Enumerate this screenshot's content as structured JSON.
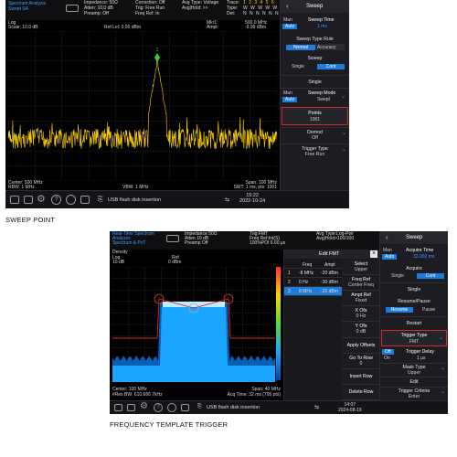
{
  "screen1": {
    "hdr": {
      "title1": "Spectrum Analysis",
      "title2": "Swept SA",
      "imp": "Impedance: 50Ω",
      "atten": "Atten: 10.0 dB",
      "preamp": "Preamp: Off",
      "corr": "Correction: Off",
      "trig": "Trig: Free Run",
      "freqref": "Freq Ref: In",
      "avgtype": "Avg Type: Voltage",
      "avghold": "Avg|Hold: >>",
      "trace_lbl": "Trace:",
      "type_lbl": "Type:",
      "det_lbl": "Det:",
      "trace_nums": "1 2 3 4 5 6",
      "type_vals": "W W W W W W",
      "det_vals": "N N N N N N"
    },
    "plot": {
      "log": "Log",
      "scale": "Scale: 10.0 dB",
      "refl": "Ref Lel: 0.00 dBm",
      "mkr": "Mkr1:",
      "ampt": "Ampt:",
      "mkr_val": "500.0 MHz",
      "ampt_val": "-9.99 dBm",
      "marker_label": "1"
    },
    "footer": {
      "center": "Center: 500 MHz",
      "rbw": "RBW: 1 MHz",
      "vbw": "VBW: 1 MHz",
      "span": "Span: 100 MHz",
      "swt": "SWT: 1 ms, pts: 1001"
    },
    "side": {
      "title": "Sweep",
      "man": "Man",
      "auto": "Auto",
      "swtime": "Sweep Time",
      "swtime_val": "1 ms",
      "typerule": "Sweep Type Rule",
      "normal": "Normal",
      "accuracy": "Accuracy",
      "sweep": "Sweep",
      "single": "Single",
      "cont": "Cont",
      "single2": "Single",
      "man2": "Man",
      "auto2": "Auto",
      "mode": "Sweep Mode",
      "mode_val": "Swept",
      "points": "Points",
      "points_val": "1001",
      "demod": "Demod",
      "demod_val": "Off",
      "trigtype": "Trigger Type",
      "trigtype_val": "Free Run"
    },
    "statusbar": {
      "usb": "USB flash disk insertion",
      "time": "15:22",
      "date": "2022-10-24"
    }
  },
  "caption1": "SWEEP POINT",
  "screen2": {
    "hdr": {
      "title1": "Real-Time Spectrum",
      "title2": "Analyzer",
      "title3": "Spectrum & PvT",
      "imp": "Impedance 50Ω",
      "atten": "Atten 10 dB",
      "preamp": "Preamp Off",
      "trig": "Trig:FMT",
      "freqref": "Freq Ref:Int(S)",
      "poi": "100%POI 6.60 µs",
      "avgtype": "Avg Type:Log-Pwr",
      "avghold": "Avg|Hold>100/100"
    },
    "plot": {
      "density": "Density",
      "log": "Log",
      "scale": "10 dB",
      "ref": "Ref",
      "ref_val": "0 dBm",
      "center": "Center: 100 MHz",
      "rbw": "#Res BW: 610.666 7kHz",
      "span": "Span: 40 MHz",
      "acq": "Acq Time: 32 ms (795 pts)"
    },
    "edit": {
      "title": "Edit FMT",
      "close": "×",
      "col_freq": "Freq",
      "col_ampt": "Ampt",
      "rows": [
        {
          "n": "1",
          "freq": "-8 MHz",
          "ampt": "-20 dBm"
        },
        {
          "n": "2",
          "freq": "0 Hz",
          "ampt": "-30 dBm"
        },
        {
          "n": "3",
          "freq": "8 MHz",
          "ampt": "-20 dBm"
        }
      ],
      "buttons": [
        {
          "l1": "Select",
          "l2": "Upper"
        },
        {
          "l1": "Freq Ref",
          "l2": "Center Freq"
        },
        {
          "l1": "Ampt Ref",
          "l2": "Fixed"
        },
        {
          "l1": "X Ofs",
          "l2": "0 Hz"
        },
        {
          "l1": "Y Ofs",
          "l2": "0 dB"
        },
        {
          "l1": "Apply Offsets",
          "l2": ""
        },
        {
          "l1": "Go To Row",
          "l2": "0"
        },
        {
          "l1": "Insert Row",
          "l2": ""
        },
        {
          "l1": "Delete Row",
          "l2": ""
        }
      ]
    },
    "side": {
      "title": "Sweep",
      "man": "Man",
      "auto": "Auto",
      "acqtime": "Acquire Time",
      "acqtime_val": "32.002 ms",
      "acquire": "Acquire",
      "single": "Single",
      "cont": "Cont",
      "single2": "Single",
      "respause": "Resume/Pause",
      "resume": "Resume",
      "pause": "Pause",
      "restart": "Restart",
      "trigtype": "Trigger Type",
      "trigtype_val": "FMT",
      "off": "Off",
      "on": "On",
      "trigdelay": "Trigger Delay",
      "trigdelay_val": "1 µs",
      "masktype": "Mask Type",
      "masktype_val": "Upper",
      "edit": "Edit",
      "criteria": "Trigger Criteria",
      "criteria_val": "Enter"
    },
    "statusbar": {
      "usb": "USB flash disk insertion",
      "time": "14:07",
      "date": "2024-08-19"
    }
  },
  "caption2": "FREQUENCY TEMPLATE TRIGGER",
  "colors": {
    "trace": "#ffd200",
    "marker": "#35d235",
    "accent": "#1e7bd8",
    "highlight": "#d62a2a",
    "spectrum": "#1aa6ff"
  }
}
